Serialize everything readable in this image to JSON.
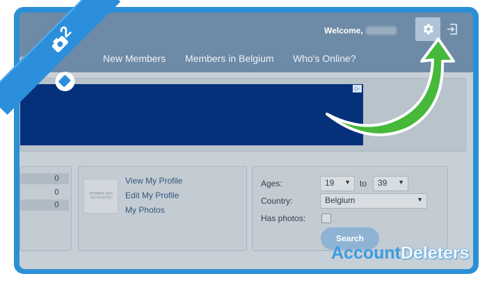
{
  "header": {
    "welcome_label": "Welcome,",
    "nav_items": [
      "ors",
      "C",
      "New Members",
      "Members in Belgium",
      "Who's Online?"
    ]
  },
  "ad": {
    "tag": "▷"
  },
  "stats": {
    "counts": [
      "0",
      "0",
      "0"
    ]
  },
  "profile": {
    "avatar_text": "MEMBER HAS NO PHOTOS",
    "links": [
      "View My Profile",
      "Edit My Profile",
      "My Photos"
    ]
  },
  "search": {
    "ages_label": "Ages:",
    "age_from": "19",
    "to_label": "to",
    "age_to": "39",
    "country_label": "Country:",
    "country_value": "Belgium",
    "photos_label": "Has photos:",
    "button_label": "Search"
  },
  "tutorial": {
    "step_number": "2"
  },
  "watermark": {
    "part1": "Account",
    "part2": "Deleters"
  },
  "colors": {
    "frame": "#2b8fd6",
    "arrow": "#46b83a",
    "header": "#6d8aa6",
    "ad": "#05317b"
  }
}
